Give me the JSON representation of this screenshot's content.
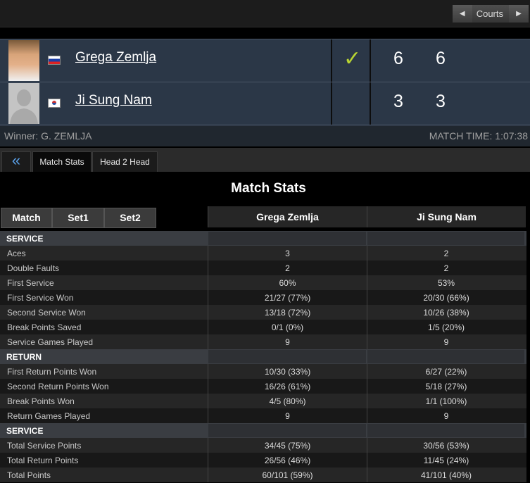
{
  "nav": {
    "courts_label": "Courts"
  },
  "players": [
    {
      "name": "Grega Zemlja",
      "country": "Slovenia",
      "set_scores": [
        "6",
        "6"
      ],
      "winner_mark": "✓"
    },
    {
      "name": "Ji Sung Nam",
      "country": "Korea",
      "set_scores": [
        "3",
        "3"
      ],
      "winner_mark": ""
    }
  ],
  "result": {
    "winner": "Winner: G. ZEMLJA",
    "match_time": "MATCH TIME: 1:07:38"
  },
  "tabs": {
    "back": "«",
    "match_stats": "Match Stats",
    "head2head": "Head 2 Head"
  },
  "stats_title": "Match Stats",
  "set_tabs": [
    "Match",
    "Set1",
    "Set2"
  ],
  "columns": [
    "Grega Zemlja",
    "Ji Sung Nam"
  ],
  "rows": [
    {
      "label": "SERVICE",
      "section": true,
      "p1": "",
      "p2": ""
    },
    {
      "label": "Aces",
      "p1": "3",
      "p2": "2"
    },
    {
      "label": "Double Faults",
      "p1": "2",
      "p2": "2"
    },
    {
      "label": "First Service",
      "p1": "60%",
      "p2": "53%"
    },
    {
      "label": "First Service Won",
      "p1": "21/27 (77%)",
      "p2": "20/30 (66%)"
    },
    {
      "label": "Second Service Won",
      "p1": "13/18 (72%)",
      "p2": "10/26 (38%)"
    },
    {
      "label": "Break Points Saved",
      "p1": "0/1 (0%)",
      "p2": "1/5 (20%)"
    },
    {
      "label": "Service Games Played",
      "p1": "9",
      "p2": "9"
    },
    {
      "label": "RETURN",
      "section": true,
      "p1": "",
      "p2": ""
    },
    {
      "label": "First Return Points Won",
      "p1": "10/30 (33%)",
      "p2": "6/27 (22%)"
    },
    {
      "label": "Second Return Points Won",
      "p1": "16/26 (61%)",
      "p2": "5/18 (27%)"
    },
    {
      "label": "Break Points Won",
      "p1": "4/5 (80%)",
      "p2": "1/1 (100%)"
    },
    {
      "label": "Return Games Played",
      "p1": "9",
      "p2": "9"
    },
    {
      "label": "SERVICE",
      "section": true,
      "p1": "",
      "p2": ""
    },
    {
      "label": "Total Service Points",
      "p1": "34/45 (75%)",
      "p2": "30/56 (53%)"
    },
    {
      "label": "Total Return Points",
      "p1": "26/56 (46%)",
      "p2": "11/45 (24%)"
    },
    {
      "label": "Total Points",
      "p1": "60/101 (59%)",
      "p2": "41/101 (40%)"
    }
  ]
}
